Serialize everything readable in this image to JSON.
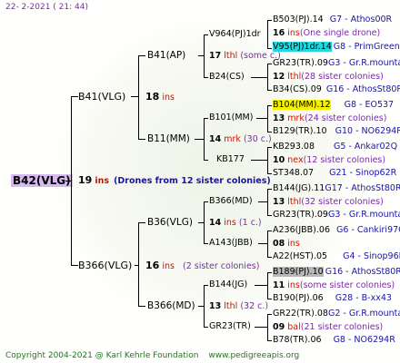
{
  "header": {
    "date": "22-  2-2021  ( 21: 44)"
  },
  "root": {
    "name": "B42(VLG)",
    "gen": "19",
    "unit": "ins",
    "note": "(Drones from 12 sister colonies)"
  },
  "gen2": [
    {
      "name": "B41(VLG)",
      "gen": "18",
      "unit": "ins",
      "note": ""
    },
    {
      "name": "B366(VLG)",
      "gen": "16",
      "unit": "ins",
      "note": "(2 sister colonies)"
    }
  ],
  "gen3": [
    {
      "name": "B41(AP)",
      "gen": "17",
      "unit": "lthl",
      "note": "(some c.)"
    },
    {
      "name": "B11(MM)",
      "gen": "14",
      "unit": "mrk",
      "note": "(30 c.)"
    },
    {
      "name": "B36(VLG)",
      "gen": "14",
      "unit": "ins",
      "note": "(1 c.)"
    },
    {
      "name": "B366(MD)",
      "gen": "13",
      "unit": "lthl",
      "note": "(32 c.)"
    }
  ],
  "gen4": [
    {
      "name": "V964(PJ)1dr"
    },
    {
      "name": "B24(CS)"
    },
    {
      "name": "B101(MM)"
    },
    {
      "name": "KB177"
    },
    {
      "name": "B366(MD)"
    },
    {
      "name": "A143(JBB)"
    },
    {
      "name": "B144(JG)"
    },
    {
      "name": "GR23(TR)"
    }
  ],
  "gen5": [
    {
      "name": "B503(PJ).14",
      "src": "G7 - Athos00R"
    },
    {
      "name": "V95(PJ)1dr.14",
      "src": "G8 - PrimGreen00"
    },
    {
      "name": "GR23(TR).09",
      "src": "G3 - Gr.R.mounta"
    },
    {
      "name": "B34(CS).09",
      "src": "G16 - AthosSt80R"
    },
    {
      "name": "B104(MM).12",
      "src": "G8 - EO537"
    },
    {
      "name": "B129(TR).10",
      "src": "G10 - NO6294R"
    },
    {
      "name": "KB293.08",
      "src": "G5 - Ankar02Q"
    },
    {
      "name": "ST348.07",
      "src": "G21 - Sinop62R"
    },
    {
      "name": "B144(JG).11",
      "src": "G17 - AthosSt80R"
    },
    {
      "name": "GR23(TR).09",
      "src": "G3 - Gr.R.mounta"
    },
    {
      "name": "A236(JBB).06",
      "src": "G6 - Cankiri97Q"
    },
    {
      "name": "A22(HST).05",
      "src": "G4 - Sinop96R"
    },
    {
      "name": "B189(PJ).10",
      "src": "G16 - AthosSt80R"
    },
    {
      "name": "B190(PJ).06",
      "src": "G28 - B-xx43"
    },
    {
      "name": "GR22(TR).08",
      "src": "G2 - Gr.R.mounta"
    },
    {
      "name": "B78(TR).06",
      "src": "G8 - NO6294R"
    }
  ],
  "gen5g": [
    {
      "gen": "16",
      "unit": "ins",
      "note": "(One single drone)"
    },
    {
      "gen": "12",
      "unit": "lthl",
      "note": "(28 sister colonies)"
    },
    {
      "gen": "13",
      "unit": "mrk",
      "note": "(24 sister colonies)"
    },
    {
      "gen": "10",
      "unit": "nex",
      "note": "(12 sister colonies)"
    },
    {
      "gen": "13",
      "unit": "lthl",
      "note": "(32 sister colonies)"
    },
    {
      "gen": "08",
      "unit": "ins",
      "note": ""
    },
    {
      "gen": "11",
      "unit": "ins",
      "note": "(some sister colonies)"
    },
    {
      "gen": "09",
      "unit": "bal",
      "note": "(21 sister colonies)"
    }
  ],
  "footer": {
    "copyright": "Copyright 2004-2021 @ Karl Kehrle Foundation",
    "website": "www.pedigreeapis.org"
  }
}
